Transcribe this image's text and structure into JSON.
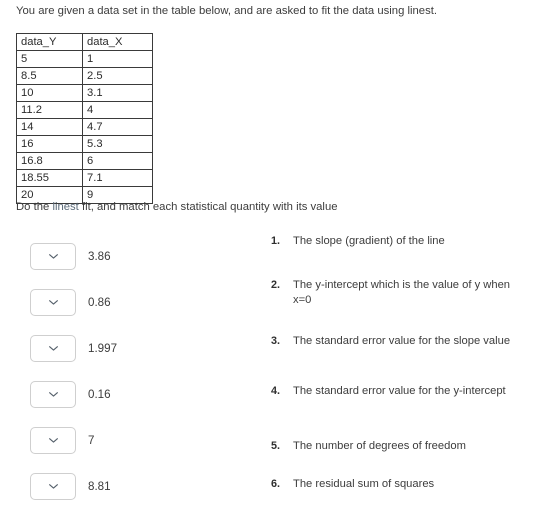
{
  "intro": {
    "text": "You are given a data set in the table below, and are asked to fit the data using linest."
  },
  "table": {
    "headers": [
      "data_Y",
      "data_X"
    ],
    "rows": [
      [
        "5",
        "1"
      ],
      [
        "8.5",
        "2.5"
      ],
      [
        "10",
        "3.1"
      ],
      [
        "11.2",
        "4"
      ],
      [
        "14",
        "4.7"
      ],
      [
        "16",
        "5.3"
      ],
      [
        "16.8",
        "6"
      ],
      [
        "18.55",
        "7.1"
      ],
      [
        "20",
        "9"
      ]
    ]
  },
  "prompt": {
    "before": "Do the ",
    "keyword": "linest",
    "after": " fit, and match each statistical quantity with its value"
  },
  "answers": [
    {
      "value": "3.86",
      "selected": "",
      "icon": "chevron-down-icon"
    },
    {
      "value": "0.86",
      "selected": "",
      "icon": "chevron-down-icon"
    },
    {
      "value": "1.997",
      "selected": "",
      "icon": "chevron-down-icon"
    },
    {
      "value": "0.16",
      "selected": "",
      "icon": "chevron-down-icon"
    },
    {
      "value": "7",
      "selected": "",
      "icon": "chevron-down-icon"
    },
    {
      "value": "8.81",
      "selected": "",
      "icon": "chevron-down-icon"
    }
  ],
  "statements": [
    {
      "number": "1.",
      "text": "The slope (gradient) of the line"
    },
    {
      "number": "2.",
      "text": "The y-intercept which is the value of y when x=0"
    },
    {
      "number": "3.",
      "text": "The standard error value for the slope value"
    },
    {
      "number": "4.",
      "text": "The standard error value for the y-intercept"
    },
    {
      "number": "5.",
      "text": "The number of degrees of freedom"
    },
    {
      "number": "6.",
      "text": "The residual sum of squares"
    }
  ],
  "colors": {
    "text": "#3c3c3c",
    "keyword": "#5b6b7a",
    "table_border": "#3a3a3a",
    "dropdown_border": "#cfcfcf",
    "background": "#ffffff"
  }
}
